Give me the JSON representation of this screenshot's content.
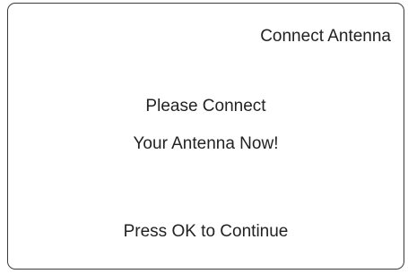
{
  "screen": {
    "title": "Connect Antenna",
    "message_line_1": "Please Connect",
    "message_line_2": "Your Antenna Now!",
    "prompt": "Press OK to Continue"
  }
}
